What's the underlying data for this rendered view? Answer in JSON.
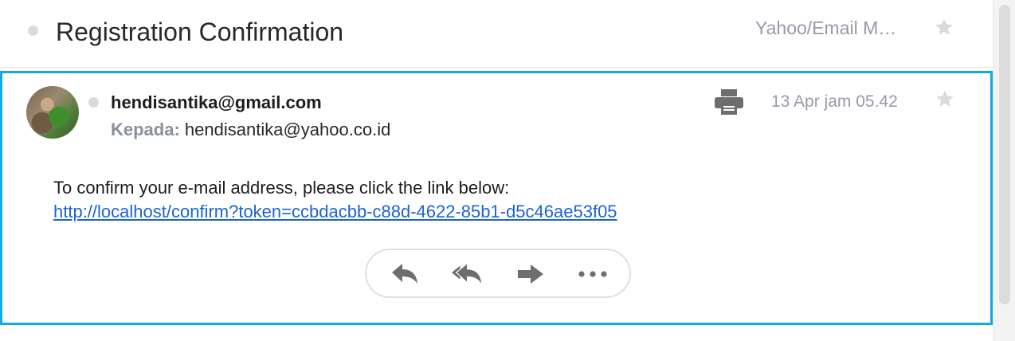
{
  "subject": {
    "title": "Registration Confirmation",
    "folder": "Yahoo/Email M…"
  },
  "message": {
    "sender": "hendisantika@gmail.com",
    "recipient_label": "Kepada:",
    "recipient": "hendisantika@yahoo.co.id",
    "date": "13 Apr jam 05.42",
    "body": "To confirm your e-mail address, please click the link below:",
    "link": "http://localhost/confirm?token=ccbdacbb-c88d-4622-85b1-d5c46ae53f05"
  },
  "actions": {
    "reply": "reply-icon",
    "reply_all": "reply-all-icon",
    "forward": "forward-icon",
    "more": "more-icon"
  },
  "colors": {
    "accent": "#12a9e6",
    "link": "#1a64d6",
    "muted": "#979ba7",
    "icon": "#6e6e70"
  }
}
